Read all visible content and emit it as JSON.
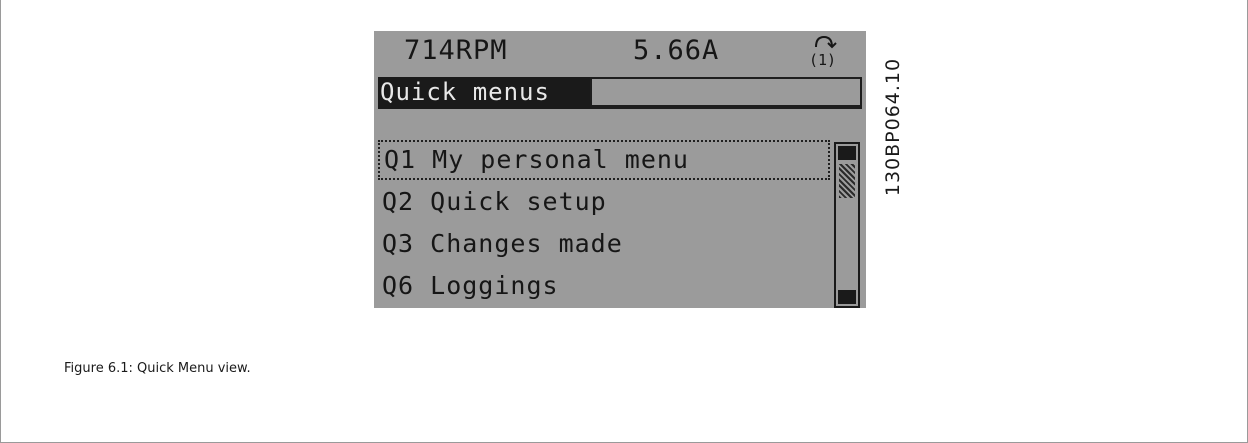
{
  "display": {
    "speed": "714RPM",
    "current": "5.66A",
    "mode_icon": "hand-on-icon",
    "title": "Quick menus",
    "items": [
      "Q1 My personal menu",
      "Q2 Quick setup",
      "Q3 Changes made",
      "Q6 Loggings"
    ]
  },
  "figure_code": "130BP064.10",
  "caption": "Figure 6.1: Quick Menu view.",
  "colors": {
    "lcd_background": "#9b9b9b",
    "lcd_text": "#161616",
    "title_bar": "#1e1e1e"
  }
}
